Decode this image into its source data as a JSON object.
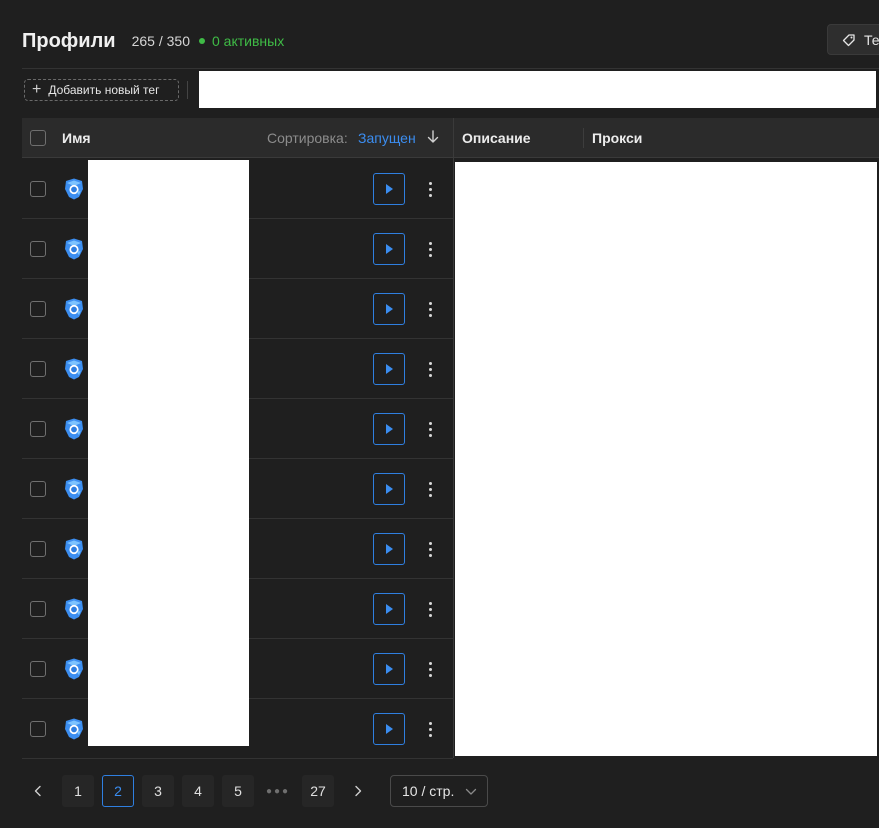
{
  "header": {
    "title": "Профили",
    "count": "265 / 350",
    "active": "0 активных",
    "tags_button": "Те"
  },
  "toolbar": {
    "add_tag_label": "Добавить новый тег"
  },
  "table": {
    "columns": {
      "name": "Имя",
      "sort_label": "Сортировка:",
      "sort_value": "Запущен",
      "description": "Описание",
      "proxy": "Прокси"
    },
    "rows": [
      {
        "icon": "browser-icon"
      },
      {
        "icon": "browser-icon"
      },
      {
        "icon": "browser-icon"
      },
      {
        "icon": "browser-icon"
      },
      {
        "icon": "browser-icon"
      },
      {
        "icon": "browser-icon"
      },
      {
        "icon": "browser-icon"
      },
      {
        "icon": "browser-icon"
      },
      {
        "icon": "browser-icon"
      },
      {
        "icon": "browser-icon"
      }
    ]
  },
  "pagination": {
    "pages": [
      "1",
      "2",
      "3",
      "4",
      "5",
      "27"
    ],
    "current": "2",
    "per_page": "10 / стр."
  },
  "colors": {
    "accent": "#2f7fe0",
    "active_green": "#3fbb46",
    "background": "#1f1f1f"
  }
}
